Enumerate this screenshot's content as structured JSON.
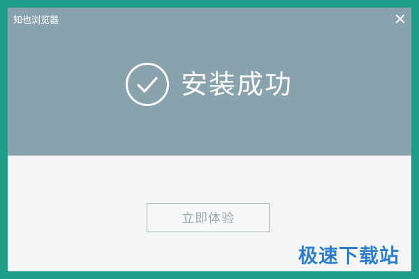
{
  "window": {
    "title": "知也浏览器",
    "close_icon": "close-icon"
  },
  "status": {
    "icon": "check-circle-icon",
    "message": "安装成功"
  },
  "actions": {
    "primary_label": "立即体验"
  },
  "watermark": {
    "text": "极速下载站"
  },
  "colors": {
    "outer_frame": "#1e9e88",
    "header_background": "#88a3ae",
    "body_background": "#f5f5f5",
    "button_border": "#9fb2ba",
    "button_text": "#9aa9b0",
    "watermark_text": "#2b7fd3"
  }
}
